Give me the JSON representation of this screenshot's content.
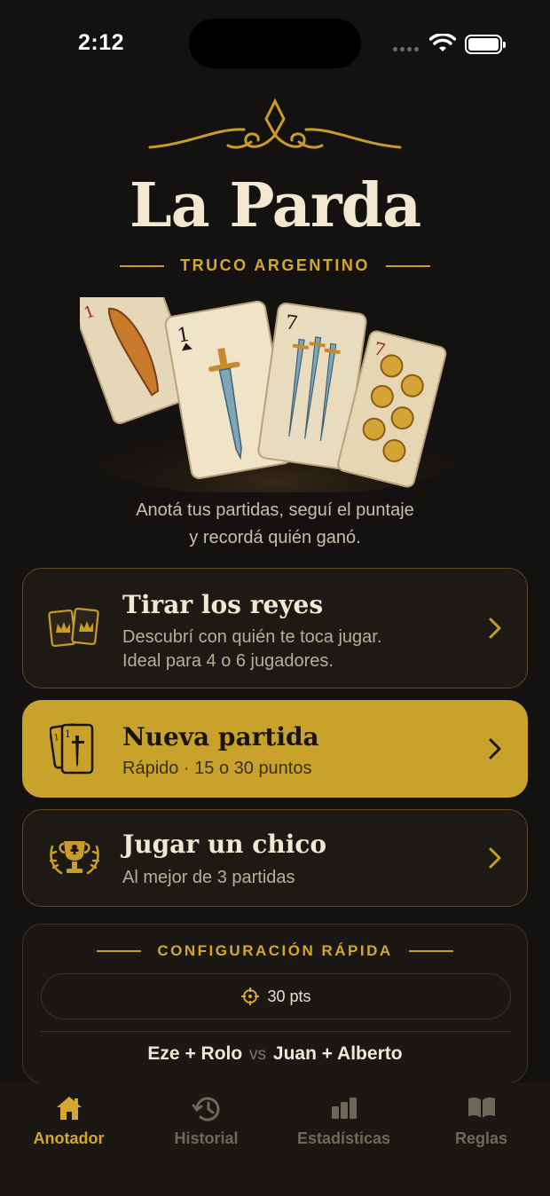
{
  "status_bar": {
    "time": "2:12"
  },
  "header": {
    "title": "La Parda",
    "subtitle": "TRUCO ARGENTINO",
    "tagline_line1": "Anotá tus partidas, seguí el puntaje",
    "tagline_line2": "y recordá quién ganó."
  },
  "hero_cards": [
    "1",
    "1",
    "7",
    "7"
  ],
  "actions": [
    {
      "title": "Tirar los reyes",
      "desc_line1": "Descubrí con quién te toca jugar.",
      "desc_line2": "Ideal para 4 o 6 jugadores.",
      "icon": "crown-cards-icon"
    },
    {
      "title": "Nueva partida",
      "desc_line1": "Rápido · 15 o 30 puntos",
      "icon": "sword-cards-icon"
    },
    {
      "title": "Jugar un chico",
      "desc_line1": "Al mejor de 3 partidas",
      "icon": "trophy-icon"
    }
  ],
  "config": {
    "title": "CONFIGURACIÓN RÁPIDA",
    "points": "30 pts",
    "team_a": "Eze + Rolo",
    "vs": "vs",
    "team_b": "Juan + Alberto"
  },
  "tabs": [
    {
      "label": "Anotador",
      "icon": "home-icon",
      "active": true
    },
    {
      "label": "Historial",
      "icon": "history-icon",
      "active": false
    },
    {
      "label": "Estadísticas",
      "icon": "bar-chart-icon",
      "active": false
    },
    {
      "label": "Reglas",
      "icon": "book-icon",
      "active": false
    }
  ],
  "colors": {
    "accent": "#d4a72e",
    "background": "#141210",
    "primary_card": "#c9a22b"
  }
}
